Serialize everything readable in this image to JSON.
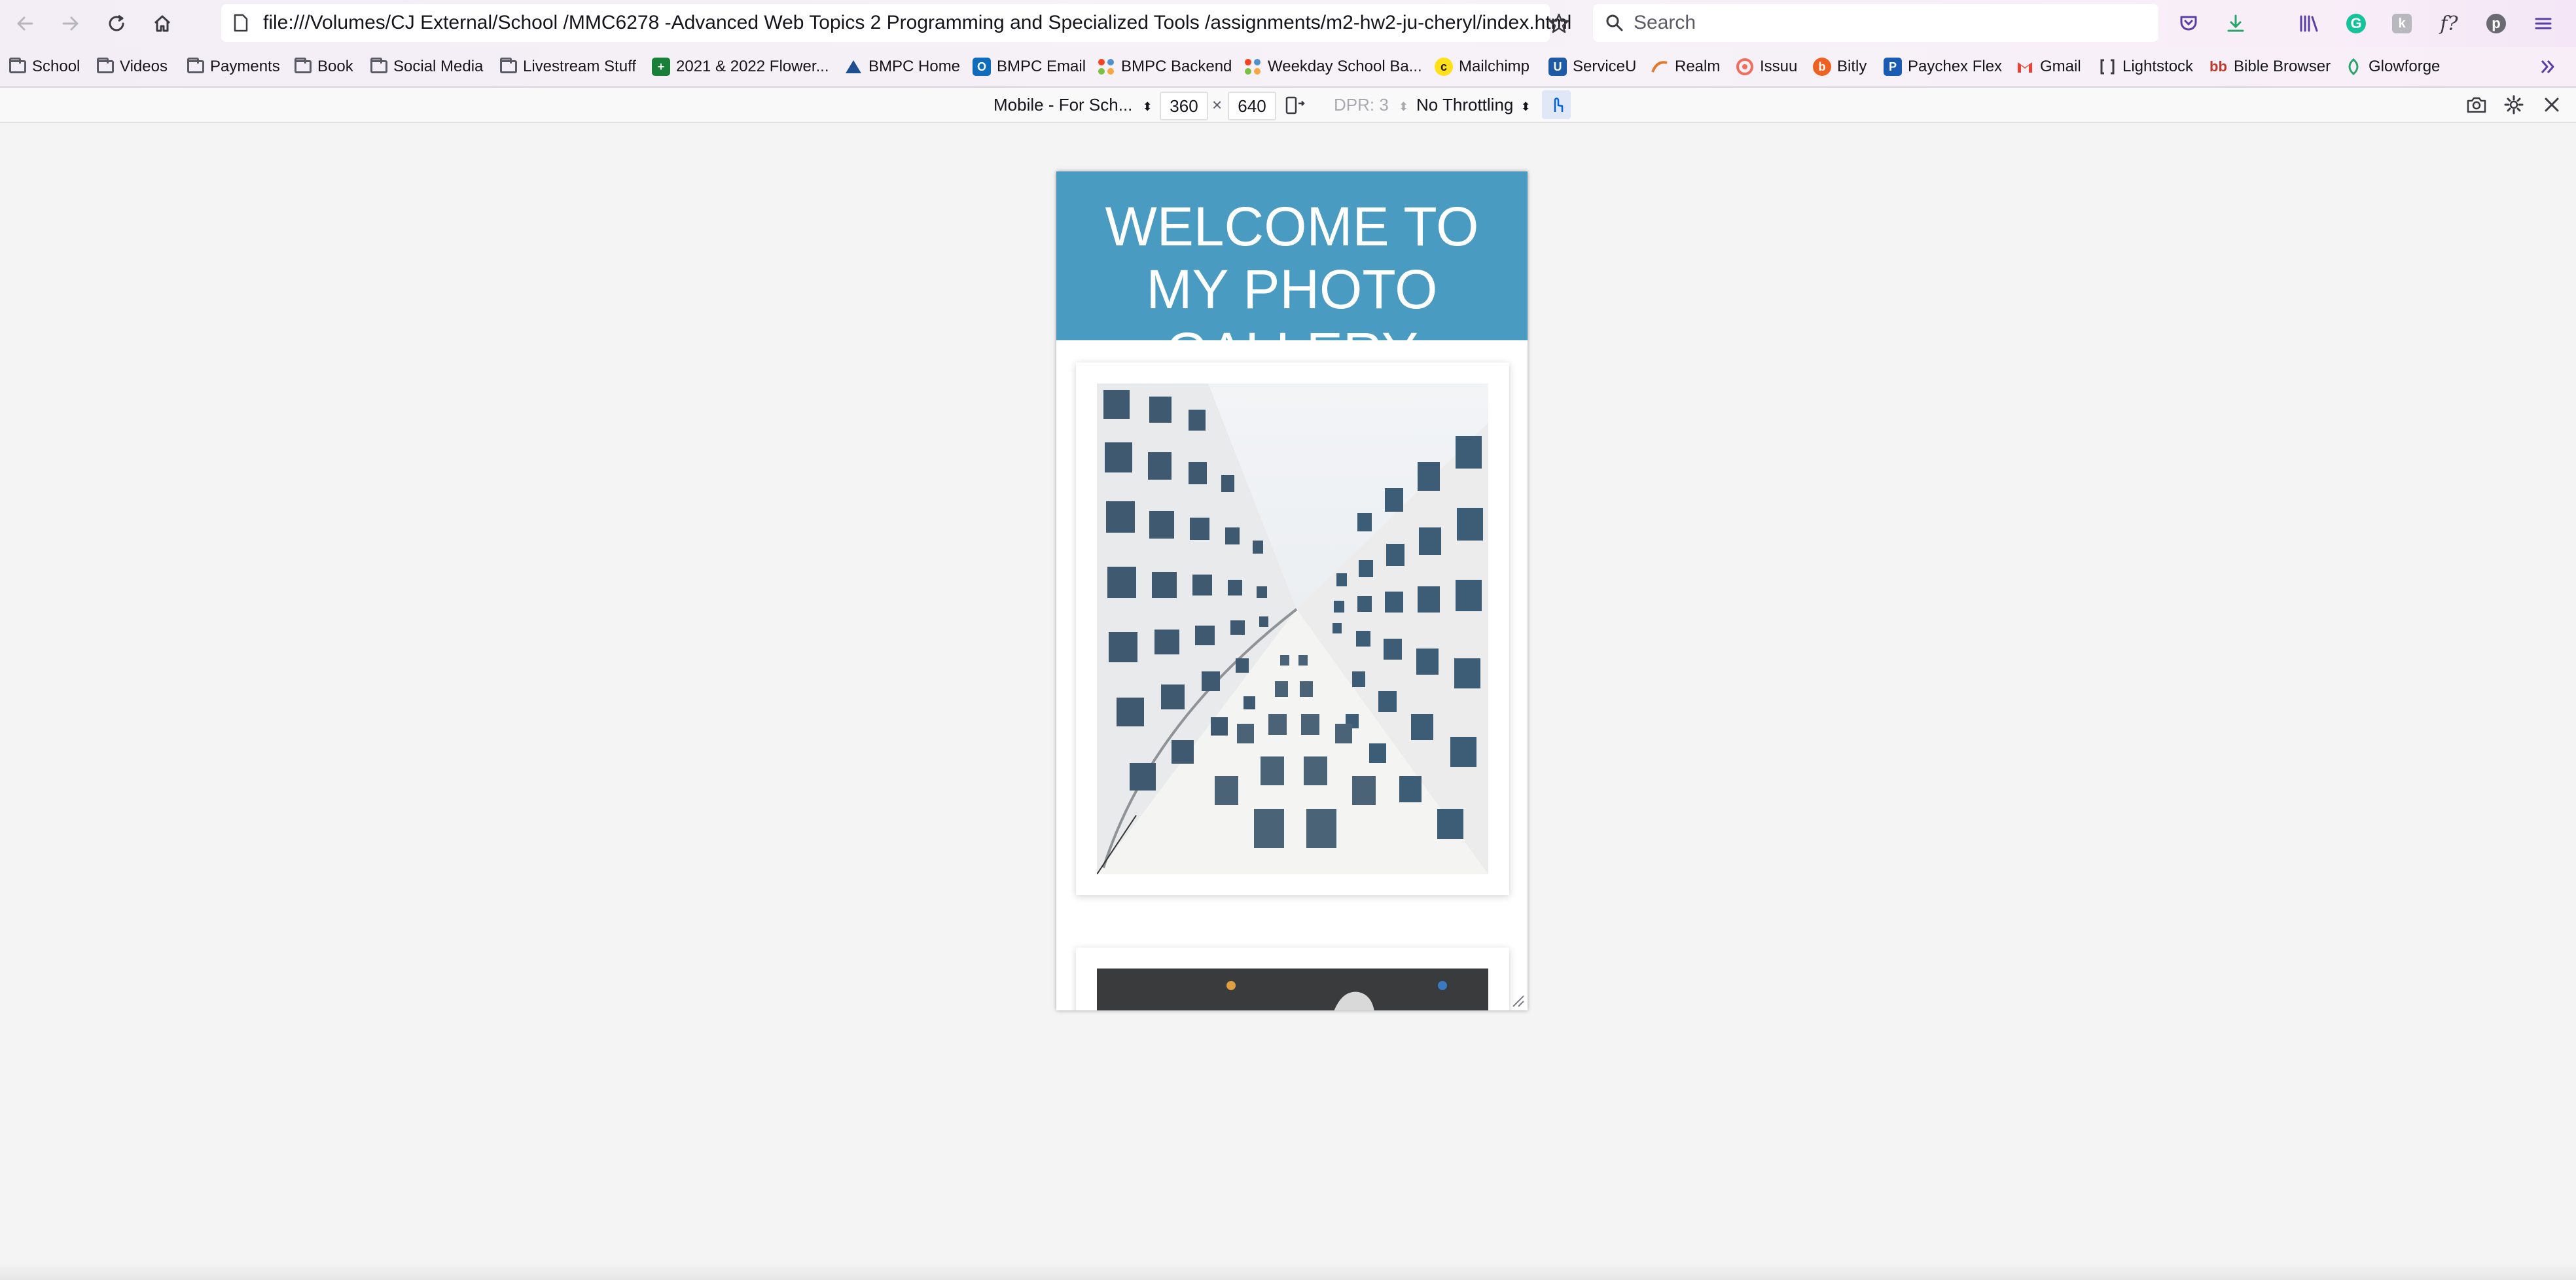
{
  "browser": {
    "url": "file:///Volumes/CJ External/School /MMC6278 -Advanced Web Topics 2 Programming and Specialized Tools /assignments/m2-hw2-ju-cheryl/index.html",
    "search_placeholder": "Search"
  },
  "bookmarks": [
    {
      "label": "School",
      "icon": "folder-icon"
    },
    {
      "label": "Videos",
      "icon": "folder-icon"
    },
    {
      "label": "Payments",
      "icon": "folder-icon"
    },
    {
      "label": "Book",
      "icon": "folder-icon"
    },
    {
      "label": "Social Media",
      "icon": "folder-icon"
    },
    {
      "label": "Livestream Stuff",
      "icon": "folder-icon"
    },
    {
      "label": "2021 & 2022 Flower...",
      "icon": "sheets-icon"
    },
    {
      "label": "BMPC Home",
      "icon": "bmpc-icon"
    },
    {
      "label": "BMPC Email",
      "icon": "outlook-icon"
    },
    {
      "label": "BMPC Backend",
      "icon": "joomla-icon"
    },
    {
      "label": "Weekday School Ba...",
      "icon": "joomla-icon"
    },
    {
      "label": "Mailchimp",
      "icon": "mailchimp-icon"
    },
    {
      "label": "ServiceU",
      "icon": "serviceu-icon"
    },
    {
      "label": "Realm",
      "icon": "realm-icon"
    },
    {
      "label": "Issuu",
      "icon": "issuu-icon"
    },
    {
      "label": "Bitly",
      "icon": "bitly-icon"
    },
    {
      "label": "Paychex Flex",
      "icon": "paychex-icon"
    },
    {
      "label": "Gmail",
      "icon": "gmail-icon"
    },
    {
      "label": "Lightstock",
      "icon": "lightstock-icon"
    },
    {
      "label": "Bible Browser",
      "icon": "bible-browser-icon"
    },
    {
      "label": "Glowforge",
      "icon": "glowforge-icon"
    }
  ],
  "rdm": {
    "device": "Mobile - For Sch...",
    "width": "360",
    "times": "×",
    "height": "640",
    "dpr": "DPR: 3",
    "throttling": "No Throttling"
  },
  "page": {
    "heading": "WELCOME TO MY PHOTO GALLERY",
    "header_color": "#4a9bc2"
  }
}
